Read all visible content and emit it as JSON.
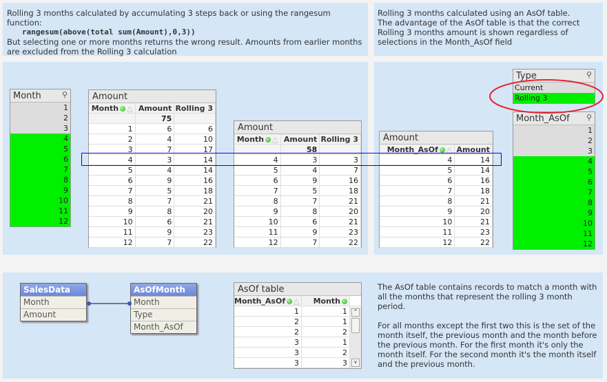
{
  "top_left": {
    "line1": "Rolling 3 months calculated by accumulating 3 steps back or using the rangesum function:",
    "code": "rangesum(above(total sum(Amount),0,3))",
    "line2": "But selecting one or more months returns the wrong result. Amounts from earlier months are excluded from the Rolling 3 calculation"
  },
  "top_right": {
    "line1": "Rolling 3 months calculated using an AsOf table.",
    "line2": "The advantage of the AsOf table is that the correct Rolling 3 months amount is shown regardless of selections in the Month_AsOf field"
  },
  "month_listbox": {
    "title": "Month",
    "values": [
      "1",
      "2",
      "3",
      "4",
      "5",
      "6",
      "7",
      "8",
      "9",
      "10",
      "11",
      "12"
    ],
    "selected": [
      "4",
      "5",
      "6",
      "7",
      "8",
      "9",
      "10",
      "11",
      "12"
    ]
  },
  "table1": {
    "title": "Amount",
    "headers": [
      "Month",
      "Amount",
      "Rolling 3"
    ],
    "total": "75",
    "rows": [
      [
        "1",
        "6",
        "6"
      ],
      [
        "2",
        "4",
        "10"
      ],
      [
        "3",
        "7",
        "17"
      ],
      [
        "4",
        "3",
        "14"
      ],
      [
        "5",
        "4",
        "14"
      ],
      [
        "6",
        "9",
        "16"
      ],
      [
        "7",
        "5",
        "18"
      ],
      [
        "8",
        "7",
        "21"
      ],
      [
        "9",
        "8",
        "20"
      ],
      [
        "10",
        "6",
        "21"
      ],
      [
        "11",
        "9",
        "23"
      ],
      [
        "12",
        "7",
        "22"
      ]
    ]
  },
  "table2": {
    "title": "Amount",
    "headers": [
      "Month",
      "Amount",
      "Rolling 3"
    ],
    "total": "58",
    "rows": [
      [
        "4",
        "3",
        "3"
      ],
      [
        "5",
        "4",
        "7"
      ],
      [
        "6",
        "9",
        "16"
      ],
      [
        "7",
        "5",
        "18"
      ],
      [
        "8",
        "7",
        "21"
      ],
      [
        "9",
        "8",
        "20"
      ],
      [
        "10",
        "6",
        "21"
      ],
      [
        "11",
        "9",
        "23"
      ],
      [
        "12",
        "7",
        "22"
      ]
    ]
  },
  "table3": {
    "title": "Amount",
    "headers": [
      "Month_AsOf",
      "Amount"
    ],
    "rows": [
      [
        "4",
        "14"
      ],
      [
        "5",
        "14"
      ],
      [
        "6",
        "16"
      ],
      [
        "7",
        "18"
      ],
      [
        "8",
        "21"
      ],
      [
        "9",
        "20"
      ],
      [
        "10",
        "21"
      ],
      [
        "11",
        "23"
      ],
      [
        "12",
        "22"
      ]
    ]
  },
  "type_listbox": {
    "title": "Type",
    "values": [
      "Current",
      "Rolling 3"
    ],
    "selected": [
      "Rolling 3"
    ]
  },
  "month_asof_listbox": {
    "title": "Month_AsOf",
    "values": [
      "1",
      "2",
      "3",
      "4",
      "5",
      "6",
      "7",
      "8",
      "9",
      "10",
      "11",
      "12"
    ],
    "selected": [
      "4",
      "5",
      "6",
      "7",
      "8",
      "9",
      "10",
      "11",
      "12"
    ]
  },
  "schema": {
    "salesdata": {
      "title": "SalesData",
      "fields": [
        "Month",
        "Amount"
      ]
    },
    "asofmonth": {
      "title": "AsOfMonth",
      "fields": [
        "Month",
        "Type",
        "Month_AsOf"
      ]
    }
  },
  "asof_table": {
    "title": "AsOf table",
    "headers": [
      "Month_AsOf",
      "Month"
    ],
    "rows": [
      [
        "1",
        "1"
      ],
      [
        "2",
        "1"
      ],
      [
        "2",
        "2"
      ],
      [
        "3",
        "1"
      ],
      [
        "3",
        "2"
      ],
      [
        "3",
        "3"
      ]
    ]
  },
  "bottom_text": {
    "p1": "The AsOf table contains records to match a month with all the months that represent the rolling 3 month period.",
    "p2": "For all months except the first two this is the set of the month itself, the previous month and the month before the previous month. For the first month it's only the month itself. For the second month it's the month itself and the previous month."
  },
  "colors": {
    "panel": "#d5e6f6",
    "selected": "#00f000",
    "highlight": "#0000ff",
    "annotation": "#e8202a"
  }
}
